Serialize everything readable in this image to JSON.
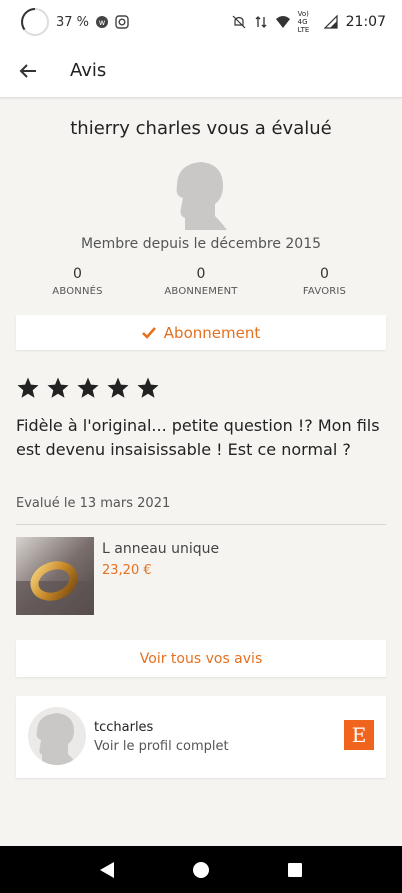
{
  "status_bar": {
    "battery": "37 %",
    "time": "21:07",
    "network": "Vo) 4G LTE"
  },
  "app_bar": {
    "title": "Avis"
  },
  "reviewer": {
    "title": "thierry charles vous a évalué",
    "member_since": "Membre depuis le décembre 2015"
  },
  "stats": [
    {
      "value": "0",
      "label": "ABONNÉS"
    },
    {
      "value": "0",
      "label": "ABONNEMENT"
    },
    {
      "value": "0",
      "label": "FAVORIS"
    }
  ],
  "follow_button": {
    "label": "Abonnement"
  },
  "review": {
    "rating": 5,
    "text": "Fidèle à l'original... petite question !? Mon fils est devenu insaisissable ! Est ce normal ?",
    "date": "Evalué le 13 mars 2021"
  },
  "product": {
    "name": "L anneau unique",
    "price": "23,20 €"
  },
  "all_reviews_button": {
    "label": "Voir tous vos avis"
  },
  "profile": {
    "username": "tccharles",
    "link": "Voir le profil complet",
    "logo_letter": "E"
  },
  "colors": {
    "accent": "#e5701f",
    "etsy": "#f1641e",
    "background": "#f5f4f1"
  }
}
